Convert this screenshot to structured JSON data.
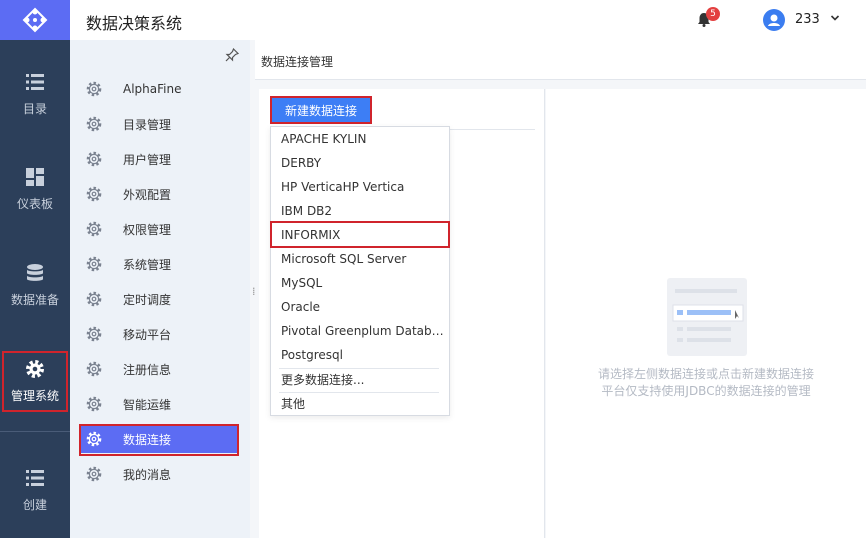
{
  "header": {
    "app_title": "数据决策系统",
    "notification_count": "5",
    "user_name": "233"
  },
  "rail": {
    "items": [
      {
        "label": "目录",
        "icon": "list-icon"
      },
      {
        "label": "仪表板",
        "icon": "dashboard-icon"
      },
      {
        "label": "数据准备",
        "icon": "database-icon"
      },
      {
        "label": "管理系统",
        "icon": "gear-icon",
        "active": true
      },
      {
        "label": "创建",
        "icon": "list-icon"
      }
    ]
  },
  "sidebar": {
    "items": [
      {
        "label": "AlphaFine"
      },
      {
        "label": "目录管理"
      },
      {
        "label": "用户管理"
      },
      {
        "label": "外观配置"
      },
      {
        "label": "权限管理"
      },
      {
        "label": "系统管理"
      },
      {
        "label": "定时调度"
      },
      {
        "label": "移动平台"
      },
      {
        "label": "注册信息"
      },
      {
        "label": "智能运维"
      },
      {
        "label": "数据连接",
        "active": true
      },
      {
        "label": "我的消息"
      }
    ]
  },
  "main": {
    "breadcrumb": "数据连接管理",
    "new_button_label": "新建数据连接",
    "dropdown": [
      "APACHE KYLIN",
      "DERBY",
      "HP VerticaHP Vertica",
      "IBM DB2",
      "INFORMIX",
      "Microsoft SQL Server",
      "MySQL",
      "Oracle",
      "Pivotal Greenplum Databa...",
      "Postgresql"
    ],
    "more_connections": "更多数据连接...",
    "other": "其他",
    "empty_line1": "请选择左侧数据连接或点击新建数据连接",
    "empty_line2": "平台仅支持使用JDBC的数据连接的管理"
  },
  "colors": {
    "accent": "#5c6cf3",
    "rail_bg": "#2c3f5a",
    "highlight_border": "#d0242c"
  }
}
